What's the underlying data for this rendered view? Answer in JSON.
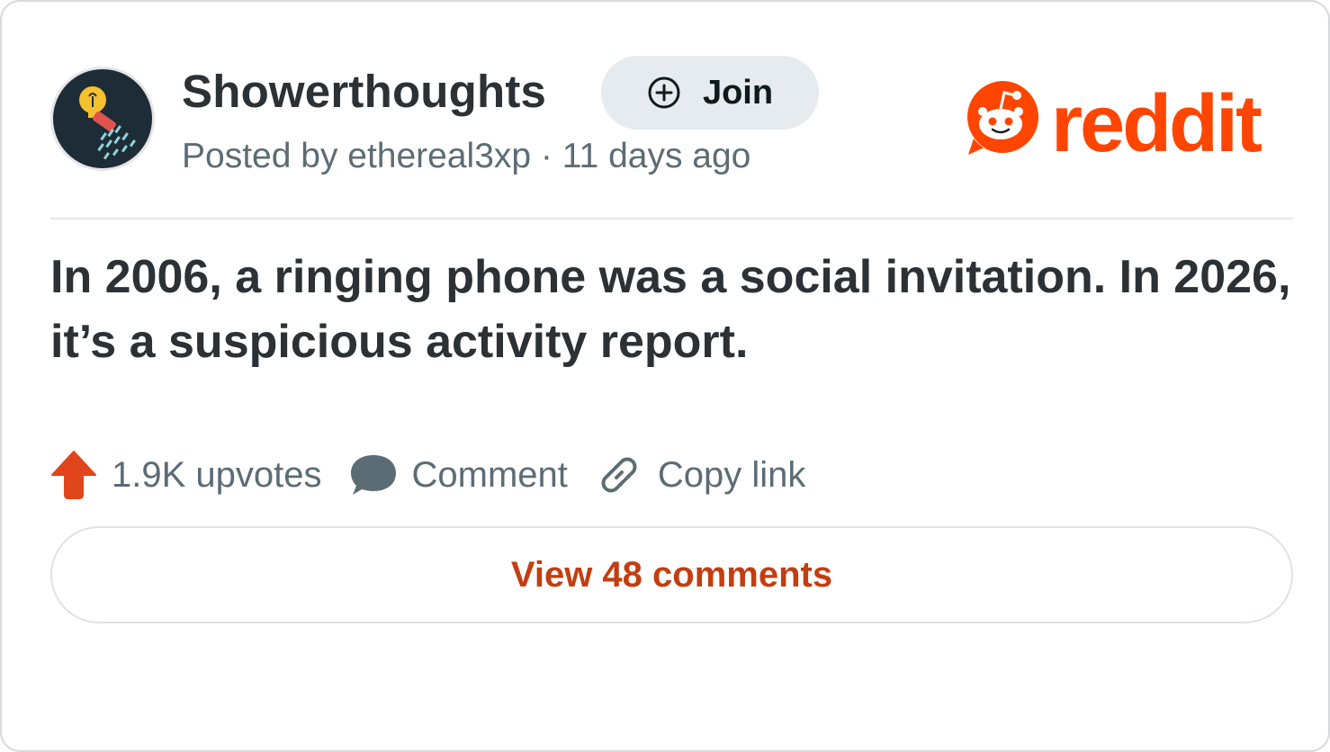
{
  "post": {
    "subreddit": "Showerthoughts",
    "join_label": "Join",
    "meta": "Posted by ethereal3xp · 11 days ago",
    "title": "In 2006, a ringing phone was a social invitation. In 2026, it’s a suspicious activity report.",
    "upvotes": "1.9K upvotes",
    "comment_label": "Comment",
    "copy_link_label": "Copy link",
    "view_comments_label": "View 48 comments"
  },
  "brand": {
    "logo_text": "reddit",
    "accent_color": "#ff4500",
    "link_color": "#c23e11"
  },
  "icons": [
    "subreddit-avatar",
    "plus-circle-icon",
    "reddit-snoo-icon",
    "upvote-arrow-icon",
    "comment-bubble-icon",
    "link-icon"
  ]
}
